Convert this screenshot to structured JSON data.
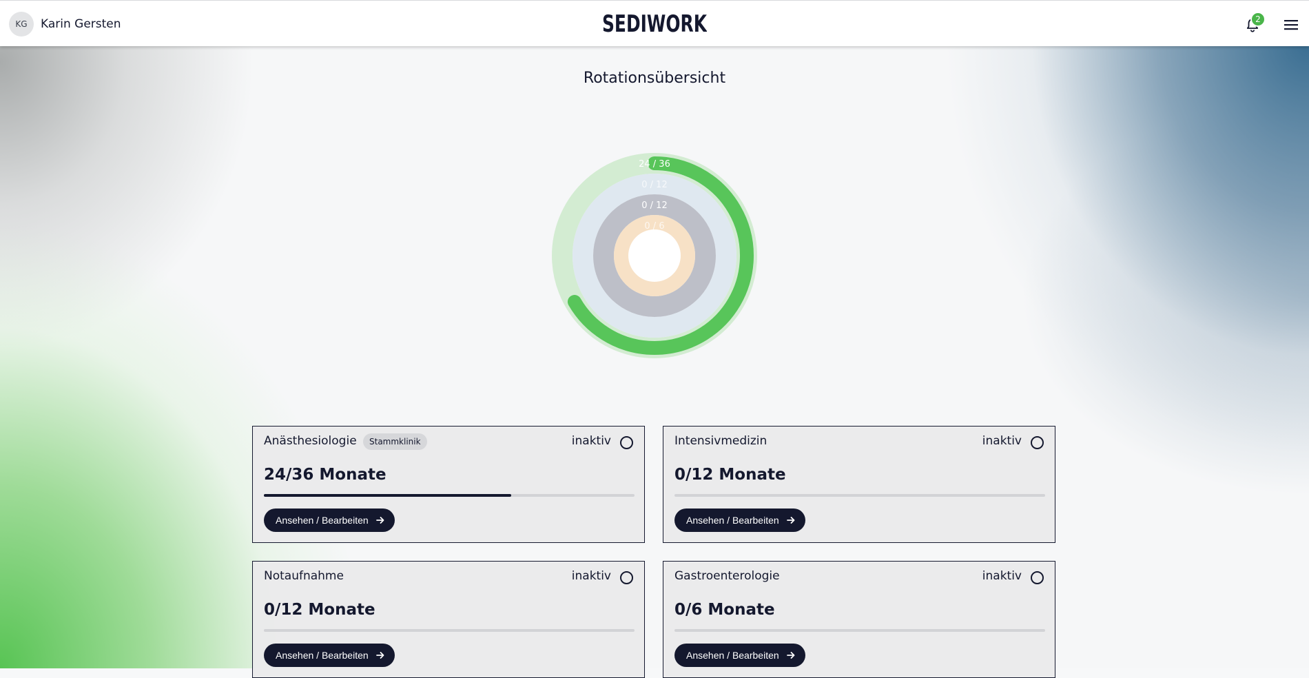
{
  "header": {
    "user_initials": "KG",
    "user_name": "Karin Gersten",
    "logo_text": "SEDIWORK",
    "notification_count": "2"
  },
  "page": {
    "title": "Rotationsübersicht"
  },
  "colors": {
    "dark": "#14182e",
    "green": "#58c55a",
    "ring_green_track": "#d3ecd2",
    "ring_blue_track": "#dfe8f0",
    "ring_gray_track": "#bdbfc8",
    "ring_peach_track": "#f7e1c6"
  },
  "chart_data": {
    "type": "radial-progress",
    "rings": [
      {
        "label": "24 / 36",
        "value": 24,
        "total": 36,
        "color": "#58c55a",
        "track": "#d3ecd2"
      },
      {
        "label": "0 / 12",
        "value": 0,
        "total": 12,
        "color": "#9fb6ca",
        "track": "#dfe8f0"
      },
      {
        "label": "0 / 12",
        "value": 0,
        "total": 12,
        "color": "#7a7e8c",
        "track": "#bdbfc8"
      },
      {
        "label": "0 / 6",
        "value": 0,
        "total": 6,
        "color": "#f0b577",
        "track": "#f7e1c6"
      }
    ]
  },
  "cards": [
    {
      "name": "Anästhesiologie",
      "tag": "Stammklinik",
      "status": "inaktiv",
      "months": "24/36 Monate",
      "progress": 0.667,
      "button": "Ansehen / Bearbeiten"
    },
    {
      "name": "Intensivmedizin",
      "tag": "",
      "status": "inaktiv",
      "months": "0/12 Monate",
      "progress": 0,
      "button": "Ansehen / Bearbeiten"
    },
    {
      "name": "Notaufnahme",
      "tag": "",
      "status": "inaktiv",
      "months": "0/12 Monate",
      "progress": 0,
      "button": "Ansehen / Bearbeiten"
    },
    {
      "name": "Gastroenterologie",
      "tag": "",
      "status": "inaktiv",
      "months": "0/6 Monate",
      "progress": 0,
      "button": "Ansehen / Bearbeiten"
    }
  ]
}
